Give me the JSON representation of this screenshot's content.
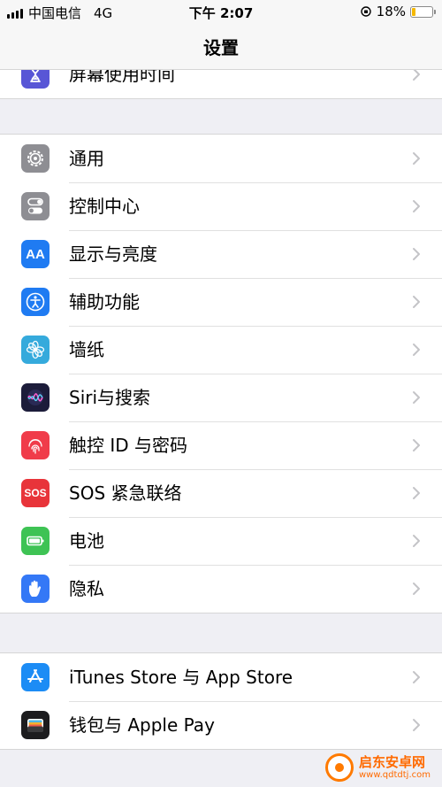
{
  "status": {
    "carrier": "中国电信",
    "network": "4G",
    "time": "下午 2:07",
    "battery": "18%",
    "battery_level": 0.18
  },
  "nav": {
    "title": "设置"
  },
  "groups": [
    {
      "rows": [
        {
          "label": "屏幕使用时间",
          "icon": "hourglass-icon",
          "color": "#5856d6"
        }
      ]
    },
    {
      "rows": [
        {
          "label": "通用",
          "icon": "gear-icon",
          "color": "#8e8e93"
        },
        {
          "label": "控制中心",
          "icon": "toggle-icon",
          "color": "#8e8e93"
        },
        {
          "label": "显示与亮度",
          "icon": "text-size-icon",
          "color": "#1f7bf2",
          "glyph": "AA"
        },
        {
          "label": "辅助功能",
          "icon": "accessibility-icon",
          "color": "#1f7bf2"
        },
        {
          "label": "墙纸",
          "icon": "flower-icon",
          "color": "#35aadc"
        },
        {
          "label": "Siri与搜索",
          "icon": "siri-icon",
          "color": "#1c1c3a"
        },
        {
          "label": "触控 ID 与密码",
          "icon": "fingerprint-icon",
          "color": "#f03c4a"
        },
        {
          "label": "SOS 紧急联络",
          "icon": "sos-icon",
          "color": "#e8343a",
          "glyph": "SOS"
        },
        {
          "label": "电池",
          "icon": "battery-icon",
          "color": "#3ec354"
        },
        {
          "label": "隐私",
          "icon": "hand-icon",
          "color": "#3478f6"
        }
      ]
    },
    {
      "rows": [
        {
          "label": "iTunes Store 与 App Store",
          "icon": "app-store-icon",
          "color": "#1c8cf5"
        },
        {
          "label": "钱包与 Apple Pay",
          "icon": "wallet-icon",
          "color": "#1c1c1e"
        }
      ]
    }
  ],
  "watermark": {
    "title": "启东安卓网",
    "url": "www.qdtdtj.com"
  }
}
